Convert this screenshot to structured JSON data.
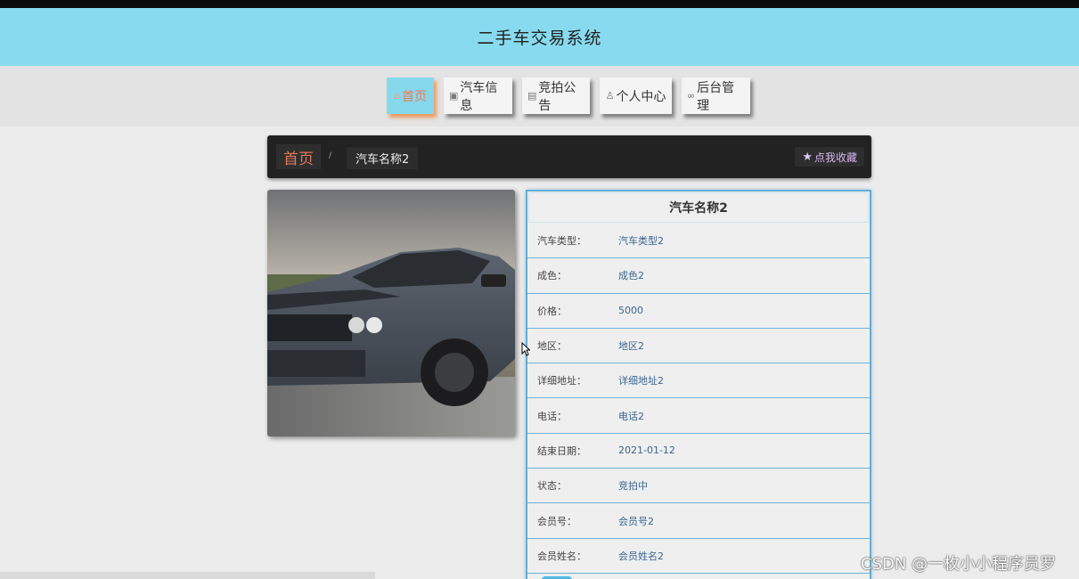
{
  "header": {
    "title": "二手车交易系统"
  },
  "nav": [
    {
      "label": "首页",
      "icon": "home-icon",
      "active": true
    },
    {
      "label": "汽车信息",
      "icon": "info-icon",
      "active": false
    },
    {
      "label": "竞拍公告",
      "icon": "notice-icon",
      "active": false
    },
    {
      "label": "个人中心",
      "icon": "user-icon",
      "active": false
    },
    {
      "label": "后台管理",
      "icon": "link-icon",
      "active": false
    }
  ],
  "breadcrumb": {
    "home": "首页",
    "separator": "/",
    "current": "汽车名称2",
    "favorite_label": "点我收藏"
  },
  "detail": {
    "title": "汽车名称2",
    "rows": [
      {
        "label": "汽车类型：",
        "value": "汽车类型2"
      },
      {
        "label": "成色：",
        "value": "成色2"
      },
      {
        "label": "价格：",
        "value": "5000"
      },
      {
        "label": "地区：",
        "value": "地区2"
      },
      {
        "label": "详细地址：",
        "value": "详细地址2"
      },
      {
        "label": "电话：",
        "value": "电话2"
      },
      {
        "label": "结束日期：",
        "value": "2021-01-12"
      },
      {
        "label": "状态：",
        "value": "竞拍中"
      },
      {
        "label": "会员号：",
        "value": "会员号2"
      },
      {
        "label": "会员姓名：",
        "value": "会员姓名2"
      }
    ]
  },
  "watermark": "CSDN @一枚小小程序员罗",
  "colors": {
    "header_bg": "#88dbef",
    "active_nav": "#86d8ed",
    "accent_orange": "#f27a4e",
    "border_blue": "#65aed4"
  }
}
